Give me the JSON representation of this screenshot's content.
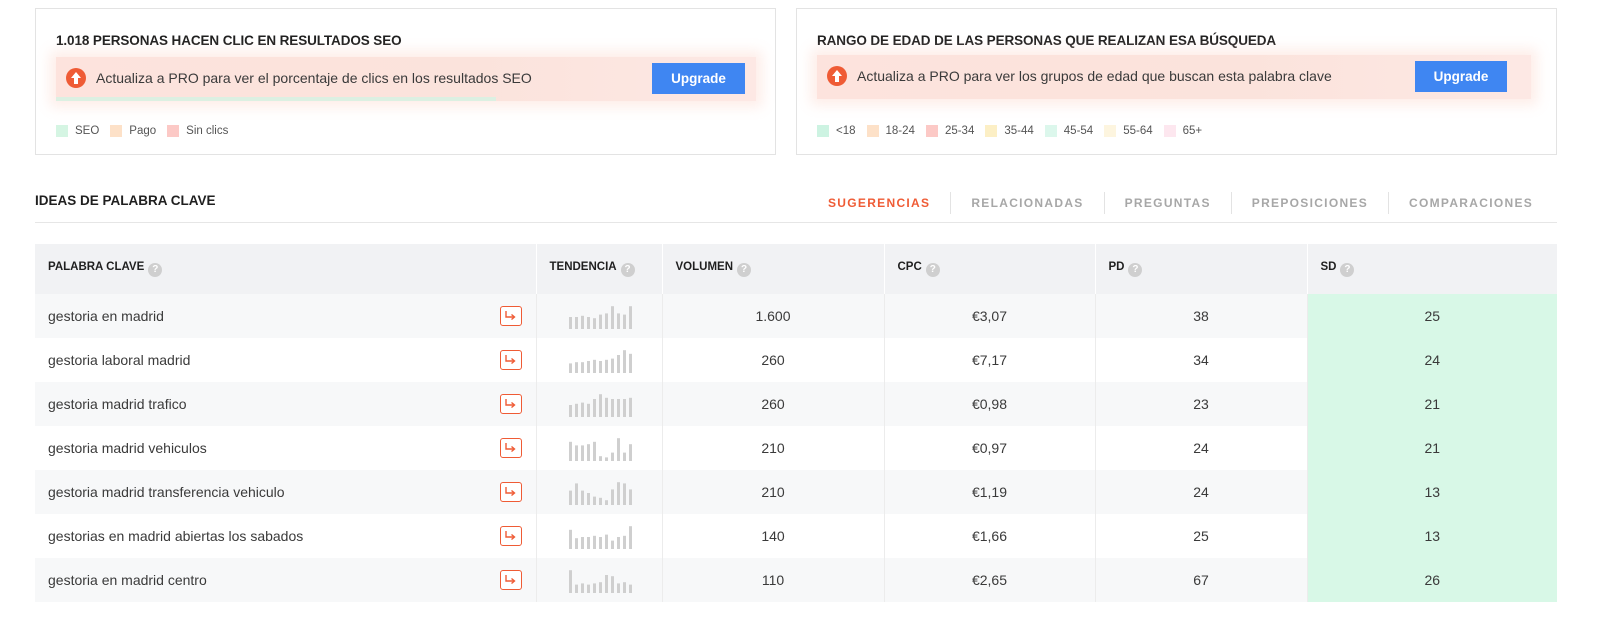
{
  "colors": {
    "accent": "#ef5b35",
    "button": "#3f86f2",
    "sd_easy": "#d8f8e7"
  },
  "seo_card": {
    "title": "1.018 PERSONAS HACEN CLIC EN RESULTADOS SEO",
    "promo_text": "Actualiza a PRO para ver el porcentaje de clics en los resultados SEO",
    "upgrade_label": "Upgrade",
    "legend": [
      {
        "label": "SEO",
        "color": "#d5f5e3"
      },
      {
        "label": "Pago",
        "color": "#fde1c8"
      },
      {
        "label": "Sin clics",
        "color": "#fcc9c6"
      }
    ]
  },
  "age_card": {
    "title": "RANGO DE EDAD DE LAS PERSONAS QUE REALIZAN ESA BÚSQUEDA",
    "promo_text": "Actualiza a PRO para ver los grupos de edad que buscan esta palabra clave",
    "upgrade_label": "Upgrade",
    "legend": [
      {
        "label": "<18",
        "color": "#cdf3e2"
      },
      {
        "label": "18-24",
        "color": "#fde1c8"
      },
      {
        "label": "25-34",
        "color": "#fcc9c6"
      },
      {
        "label": "35-44",
        "color": "#fcefc5"
      },
      {
        "label": "45-54",
        "color": "#dcf7ec"
      },
      {
        "label": "55-64",
        "color": "#fdf5df"
      },
      {
        "label": "65+",
        "color": "#fde7ef"
      }
    ]
  },
  "ideas": {
    "title": "IDEAS DE PALABRA CLAVE",
    "tabs": [
      "SUGERENCIAS",
      "RELACIONADAS",
      "PREGUNTAS",
      "PREPOSICIONES",
      "COMPARACIONES"
    ],
    "active_tab": 0
  },
  "table": {
    "headers": {
      "keyword": "PALABRA CLAVE",
      "trend": "TENDENCIA",
      "volume": "VOLUMEN",
      "cpc": "CPC",
      "pd": "PD",
      "sd": "SD"
    },
    "help_glyph": "?",
    "rows": [
      {
        "keyword": "gestoria en madrid",
        "volume": "1.600",
        "cpc": "€3,07",
        "pd": "38",
        "sd": "25",
        "trend": [
          0.5,
          0.5,
          0.55,
          0.5,
          0.45,
          0.6,
          0.65,
          0.95,
          0.65,
          0.6,
          0.95
        ]
      },
      {
        "keyword": "gestoria laboral madrid",
        "volume": "260",
        "cpc": "€7,17",
        "pd": "34",
        "sd": "24",
        "trend": [
          0.4,
          0.45,
          0.45,
          0.5,
          0.55,
          0.5,
          0.55,
          0.6,
          0.75,
          0.95,
          0.8
        ]
      },
      {
        "keyword": "gestoria madrid trafico",
        "volume": "260",
        "cpc": "€0,98",
        "pd": "23",
        "sd": "21",
        "trend": [
          0.5,
          0.55,
          0.6,
          0.55,
          0.75,
          0.95,
          0.8,
          0.75,
          0.75,
          0.75,
          0.8
        ]
      },
      {
        "keyword": "gestoria madrid vehiculos",
        "volume": "210",
        "cpc": "€0,97",
        "pd": "24",
        "sd": "21",
        "trend": [
          0.8,
          0.65,
          0.65,
          0.7,
          0.8,
          0.2,
          0.15,
          0.35,
          0.95,
          0.35,
          0.7
        ]
      },
      {
        "keyword": "gestoria madrid transferencia vehiculo",
        "volume": "210",
        "cpc": "€1,19",
        "pd": "24",
        "sd": "13",
        "trend": [
          0.6,
          0.9,
          0.6,
          0.5,
          0.35,
          0.3,
          0.2,
          0.65,
          0.95,
          0.9,
          0.65
        ]
      },
      {
        "keyword": "gestorias en madrid abiertas los sabados",
        "volume": "140",
        "cpc": "€1,66",
        "pd": "25",
        "sd": "13",
        "trend": [
          0.8,
          0.45,
          0.5,
          0.5,
          0.55,
          0.5,
          0.6,
          0.35,
          0.5,
          0.55,
          0.95
        ]
      },
      {
        "keyword": "gestoria en madrid centro",
        "volume": "110",
        "cpc": "€2,65",
        "pd": "67",
        "sd": "26",
        "trend": [
          0.95,
          0.35,
          0.4,
          0.35,
          0.4,
          0.45,
          0.75,
          0.7,
          0.4,
          0.45,
          0.35
        ]
      }
    ]
  }
}
